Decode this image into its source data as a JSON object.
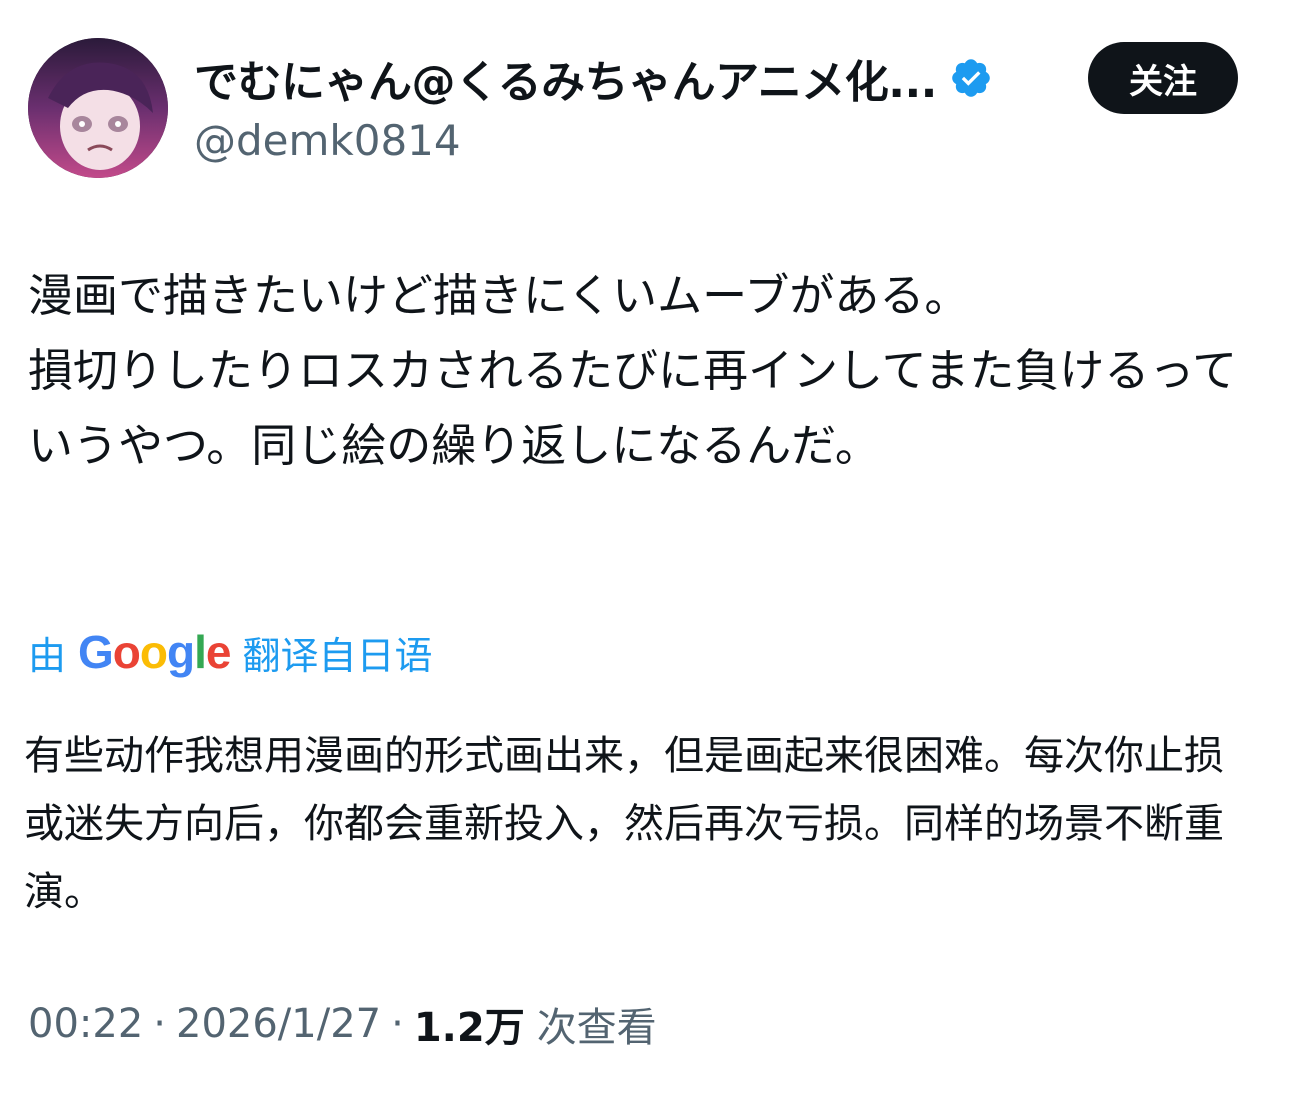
{
  "author": {
    "display_name": "でむにゃん@くるみちゃんアニメ化...",
    "handle": "@demk0814",
    "verified": true
  },
  "follow_button": {
    "label": "关注"
  },
  "tweet": {
    "text": "漫画で描きたいけど描きにくいムーブがある。\n損切りしたりロスカされるたびに再インしてまた負けるっていうやつ。同じ絵の繰り返しになるんだ。"
  },
  "translation": {
    "prefix": "由",
    "provider": "Google",
    "suffix": "翻译自日语",
    "text": "有些动作我想用漫画的形式画出来，但是画起来很困难。每次你止损或迷失方向后，你都会重新投入，然后再次亏损。同样的场景不断重演。"
  },
  "meta": {
    "time": "00:22",
    "separator": "·",
    "date": "2026/1/27",
    "views_count": "1.2万",
    "views_label": "次查看"
  },
  "colors": {
    "link_blue": "#1d9bf0",
    "secondary_text": "#536471",
    "primary_text": "#0f1419",
    "verified_badge": "#1d9bf0"
  },
  "icons": {
    "verified": "verified-badge-icon"
  }
}
